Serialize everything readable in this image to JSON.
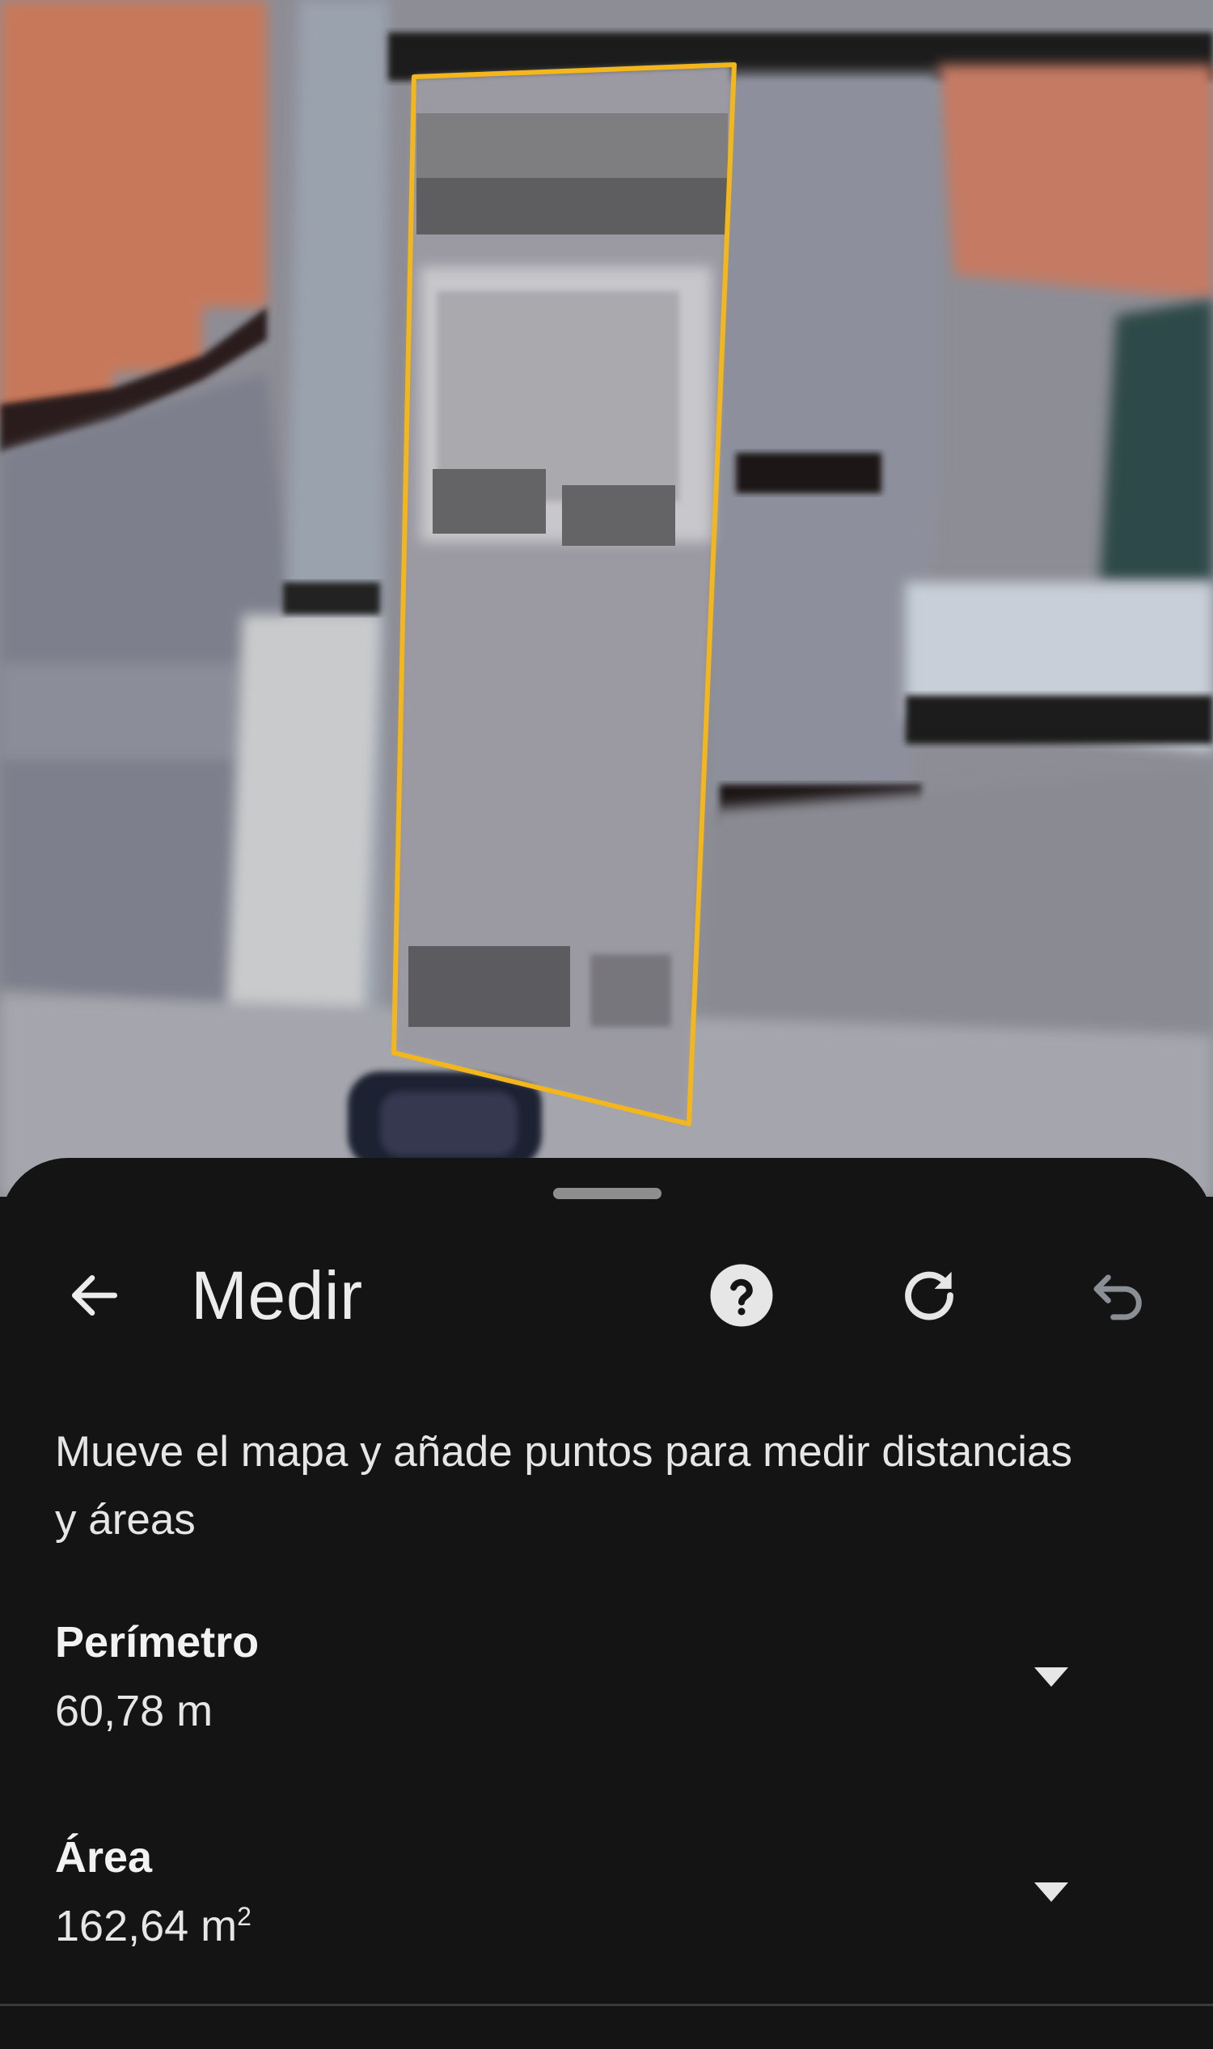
{
  "map": {
    "description_icon": "satellite-map-view",
    "outline_color": "#f3b71c"
  },
  "panel": {
    "title": "Medir",
    "instructions": "Mueve el mapa y añade puntos para medir distancias y áreas",
    "measurements": [
      {
        "label": "Perímetro",
        "value": "60,78 m",
        "unit_sup": ""
      },
      {
        "label": "Área",
        "value": "162,64 m",
        "unit_sup": "2"
      }
    ]
  },
  "icons": {
    "back": "arrow-left-icon",
    "help": "help-circle-icon",
    "refresh": "refresh-icon",
    "undo": "undo-icon",
    "dropdown": "caret-down-icon"
  },
  "colors": {
    "sheet_bg": "#141414",
    "text": "#ececec",
    "help_bg": "#e6e6e6",
    "undo_disabled": "#8a8f96"
  }
}
